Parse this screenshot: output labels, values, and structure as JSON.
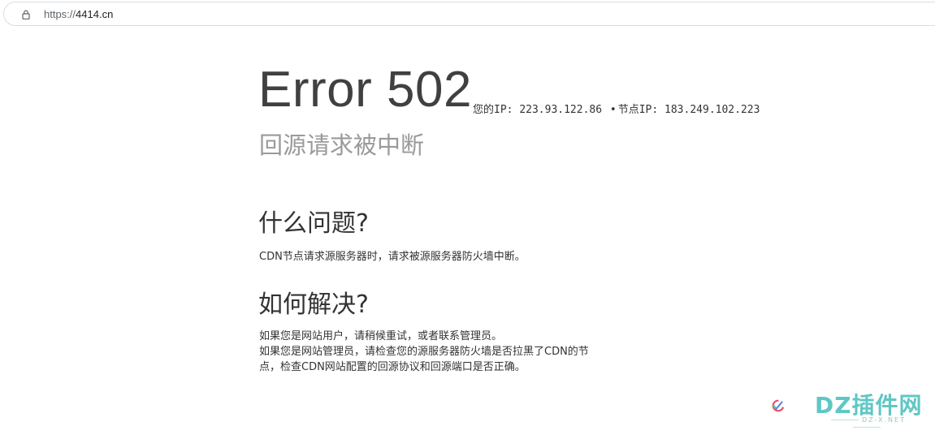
{
  "browser": {
    "url_scheme": "https://",
    "url_host": "4414.cn",
    "lock_icon": "lock-icon"
  },
  "error": {
    "title": "Error 502",
    "your_ip_label": "您的IP:",
    "your_ip": "223.93.122.86",
    "separator": "•",
    "node_ip_label": "节点IP:",
    "node_ip": "183.249.102.223",
    "subtitle": "回源请求被中断"
  },
  "what": {
    "heading": "什么问题?",
    "body": "CDN节点请求源服务器时，请求被源服务器防火墙中断。"
  },
  "how": {
    "heading": "如何解决?",
    "line1": "如果您是网站用户，请稍候重试，或者联系管理员。",
    "line2": "如果您是网站管理员，请检查您的源服务器防火墙是否拉黑了CDN的节",
    "line3": "点，检查CDN网站配置的回源协议和回源端口是否正确。"
  },
  "watermark": {
    "brand": "DZ插件网",
    "domain": "DZ-X.NET",
    "logo_icon": "checkmark-logo-icon",
    "colors": {
      "teal": "#5fc7c4",
      "red": "#e8516a",
      "blue": "#5a8de6",
      "green": "#48c9a6"
    }
  }
}
